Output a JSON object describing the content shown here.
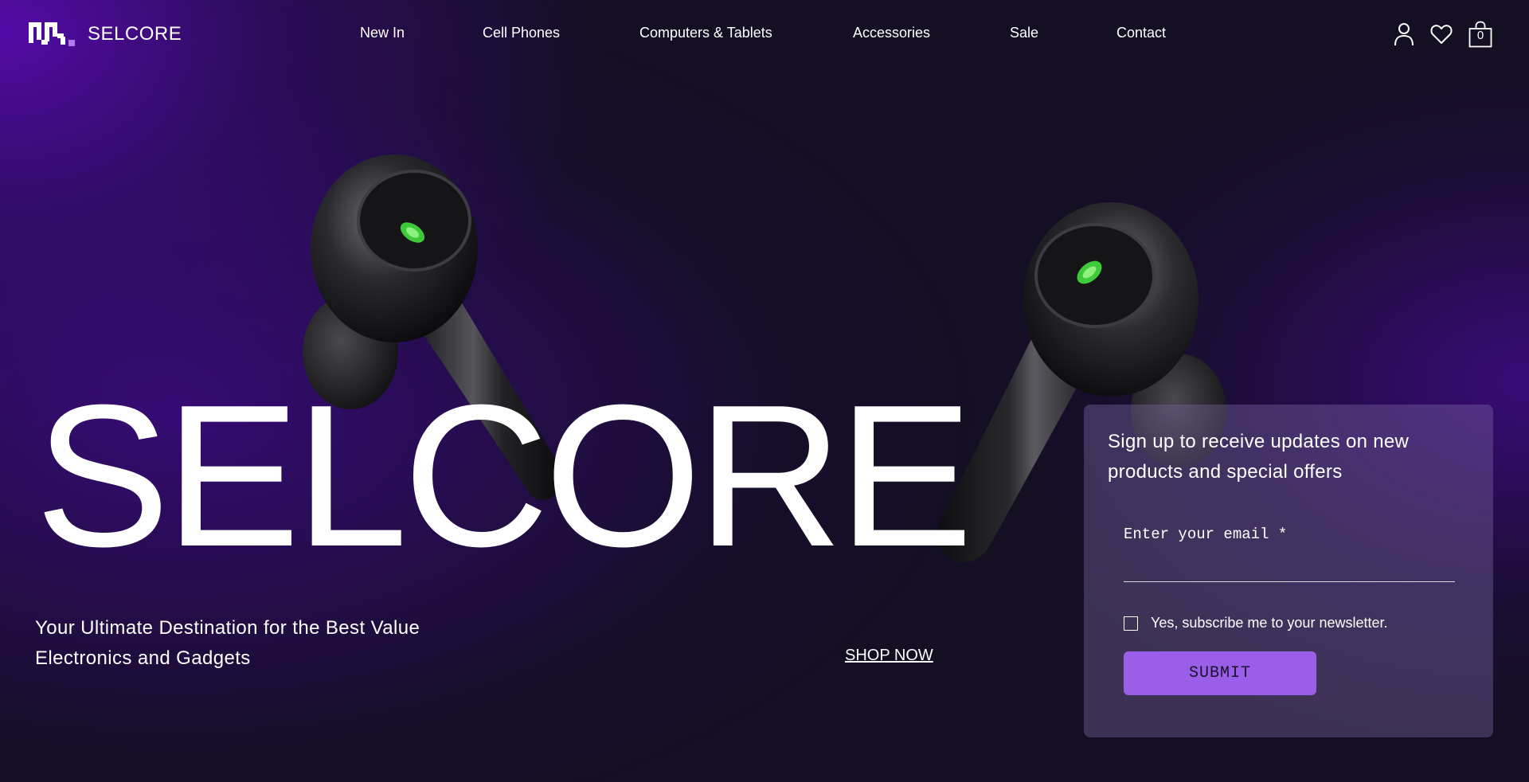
{
  "brand": {
    "name": "SELCORE",
    "accent_color": "#9b5ee8",
    "background_color": "#140f22"
  },
  "nav": {
    "items": [
      {
        "label": "New In"
      },
      {
        "label": "Cell Phones"
      },
      {
        "label": "Computers & Tablets"
      },
      {
        "label": "Accessories"
      },
      {
        "label": "Sale"
      },
      {
        "label": "Contact"
      }
    ]
  },
  "header_icons": {
    "account": "user-icon",
    "wishlist": "heart-icon",
    "cart": "shopping-bag-icon",
    "cart_count": "0"
  },
  "hero": {
    "title": "SELCORE",
    "tagline": "Your Ultimate Destination for the Best Value Electronics and Gadgets",
    "cta_label": "SHOP NOW",
    "image": "black wireless earbuds with green indicator lights"
  },
  "signup": {
    "heading": "Sign up to receive updates on new products and special offers",
    "email_label": "Enter your email",
    "required_marker": "*",
    "email_value": "",
    "subscribe_label": "Yes, subscribe me to your newsletter.",
    "subscribe_checked": false,
    "submit_label": "SUBMIT"
  }
}
